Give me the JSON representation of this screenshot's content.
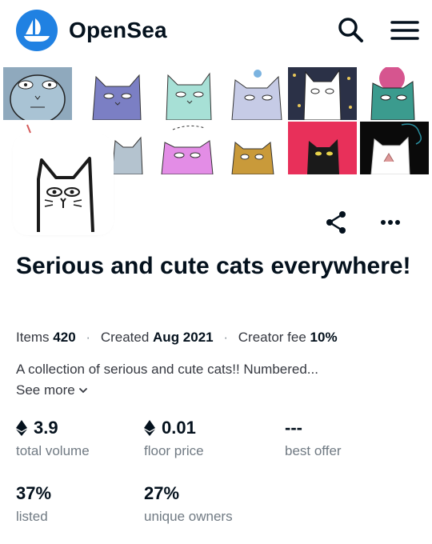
{
  "header": {
    "brand": "OpenSea",
    "logo_color": "#2081e2",
    "icons": [
      "opensea-logo",
      "search-icon",
      "hamburger-menu-icon"
    ]
  },
  "collection": {
    "title": "Serious and cute cats everywhere!",
    "items_label": "Items",
    "items_value": "420",
    "created_label": "Created",
    "created_value": "Aug 2021",
    "fee_label": "Creator fee",
    "fee_value": "10%",
    "description": "A collection of serious and cute cats!! Numbered...",
    "see_more": "See more"
  },
  "stats": {
    "total_volume": {
      "value": "3.9",
      "label": "total volume"
    },
    "floor_price": {
      "value": "0.01",
      "label": "floor price"
    },
    "best_offer": {
      "value": "---",
      "label": "best offer"
    },
    "listed": {
      "value": "37%",
      "label": "listed"
    },
    "unique_owners": {
      "value": "27%",
      "label": "unique owners"
    }
  },
  "actions": {
    "share_icon": "share-icon",
    "more_icon": "more-options-icon"
  }
}
